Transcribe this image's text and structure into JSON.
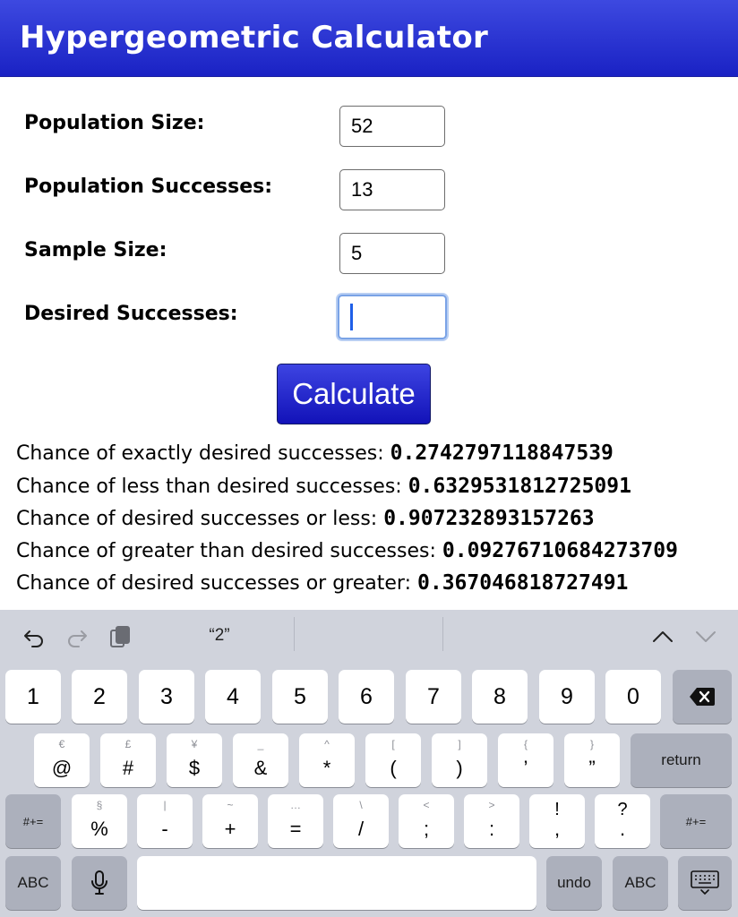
{
  "app": {
    "title": "Hypergeometric Calculator"
  },
  "form": {
    "fields": [
      {
        "label": "Population Size:",
        "value": "52"
      },
      {
        "label": "Population Successes:",
        "value": "13"
      },
      {
        "label": "Sample Size:",
        "value": "5"
      },
      {
        "label": "Desired Successes:",
        "value": ""
      }
    ],
    "calculate_label": "Calculate"
  },
  "results": [
    {
      "label": "Chance of exactly desired successes: ",
      "value": "0.2742797118847539"
    },
    {
      "label": "Chance of less than desired successes: ",
      "value": "0.6329531812725091"
    },
    {
      "label": "Chance of desired successes or less: ",
      "value": "0.907232893157263"
    },
    {
      "label": "Chance of greater than desired successes: ",
      "value": "0.09276710684273709"
    },
    {
      "label": "Chance of desired successes or greater: ",
      "value": "0.367046818727491"
    }
  ],
  "keyboard": {
    "suggestion": "“2”",
    "row1": [
      "1",
      "2",
      "3",
      "4",
      "5",
      "6",
      "7",
      "8",
      "9",
      "0"
    ],
    "row2": [
      {
        "sub": "€",
        "main": "@"
      },
      {
        "sub": "£",
        "main": "#"
      },
      {
        "sub": "¥",
        "main": "$"
      },
      {
        "sub": "_",
        "main": "&"
      },
      {
        "sub": "^",
        "main": "*"
      },
      {
        "sub": "[",
        "main": "("
      },
      {
        "sub": "]",
        "main": ")"
      },
      {
        "sub": "{",
        "main": "’"
      },
      {
        "sub": "}",
        "main": "”"
      }
    ],
    "return_label": "return",
    "shift_label": "#+=",
    "row3": [
      {
        "sub": "§",
        "main": "%"
      },
      {
        "sub": "|",
        "main": "-"
      },
      {
        "sub": "~",
        "main": "+"
      },
      {
        "sub": "…",
        "main": "="
      },
      {
        "sub": "\\",
        "main": "/"
      },
      {
        "sub": "<",
        "main": ";"
      },
      {
        "sub": ">",
        "main": ":"
      },
      {
        "sub": "!",
        "main": ","
      },
      {
        "sub": "?",
        "main": "."
      }
    ],
    "abc_label": "ABC",
    "undo_label": "undo"
  },
  "colors": {
    "header": "#2a33d6",
    "accent": "#1f5fe8",
    "keyboard_bg": "#d0d3dc"
  }
}
